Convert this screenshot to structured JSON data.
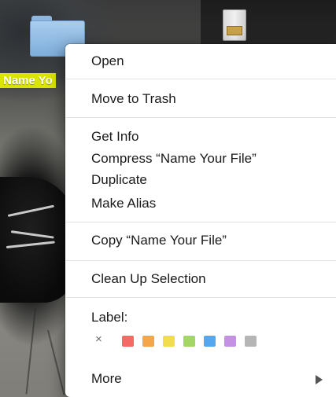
{
  "desktop": {
    "selected_file_label": "Name Yo"
  },
  "context_menu": {
    "open": "Open",
    "move_to_trash": "Move to Trash",
    "get_info": "Get Info",
    "compress": "Compress “Name Your File”",
    "duplicate": "Duplicate",
    "make_alias": "Make Alias",
    "copy": "Copy “Name Your File”",
    "clean_up_selection": "Clean Up Selection",
    "label_heading": "Label:",
    "clear_label_glyph": "×",
    "label_colors": [
      "#f36b64",
      "#f5a54a",
      "#f1dd4e",
      "#a3d667",
      "#55a8f0",
      "#c591e2",
      "#b5b5b5"
    ],
    "more": "More"
  }
}
